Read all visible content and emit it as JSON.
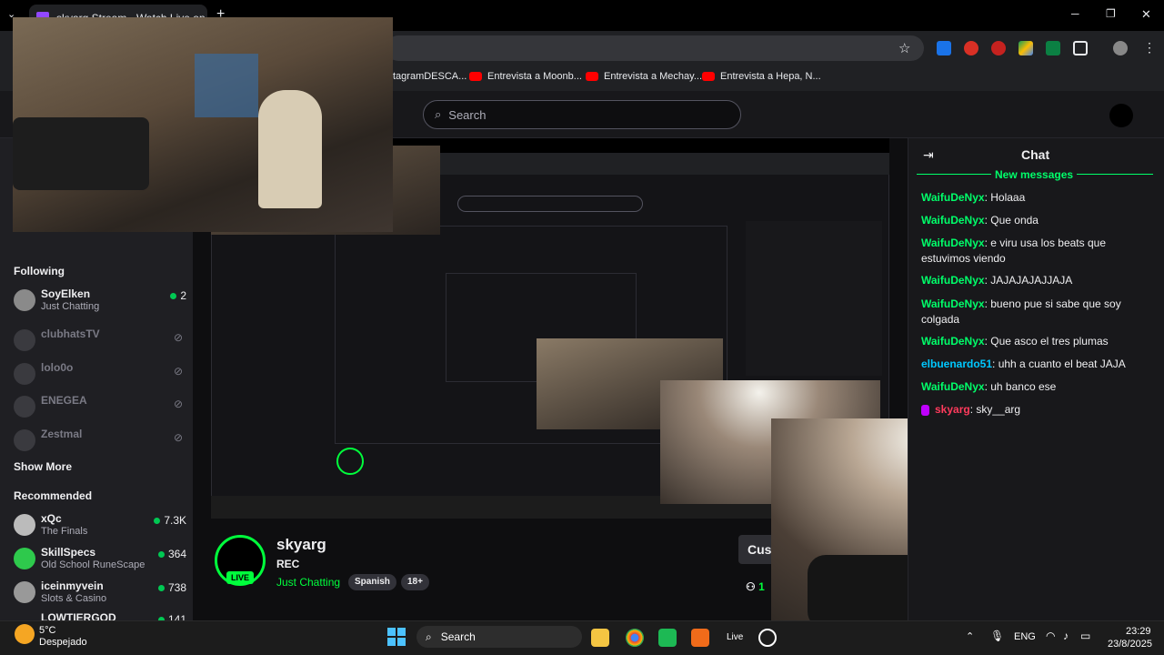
{
  "browser": {
    "tab_title": "skyarg Stream - Watch Live on",
    "new_tab": "+",
    "window_controls": {
      "minimize": "─",
      "maximize": "❐",
      "close": "✕"
    },
    "bookmarks": [
      {
        "label": "tagramDESCA...",
        "yt": false
      },
      {
        "label": "Entrevista a Moonb...",
        "yt": true
      },
      {
        "label": "Entrevista a Mechay...",
        "yt": true
      },
      {
        "label": "Entrevista a Hepa, N...",
        "yt": true
      }
    ],
    "star": "☆"
  },
  "twitch": {
    "search_placeholder": "Search",
    "sidebar": {
      "following_title": "Following",
      "following": [
        {
          "name": "SoyElken",
          "game": "Just Chatting",
          "viewers": "2",
          "online": true
        },
        {
          "name": "clubhatsTV",
          "online": false
        },
        {
          "name": "lolo0o",
          "online": false
        },
        {
          "name": "ENEGEA",
          "online": false
        },
        {
          "name": "Zestmal",
          "online": false
        }
      ],
      "show_more": "Show More",
      "recommended_title": "Recommended",
      "recommended": [
        {
          "name": "xQc",
          "game": "The Finals",
          "viewers": "7.3K"
        },
        {
          "name": "SkillSpecs",
          "game": "Old School RuneScape",
          "viewers": "364"
        },
        {
          "name": "iceinmyvein",
          "game": "Slots & Casino",
          "viewers": "738"
        },
        {
          "name": "LOWTIERGOD",
          "game": "",
          "viewers": "141"
        }
      ]
    },
    "chat": {
      "title": "Chat",
      "new_messages": "New messages",
      "messages": [
        {
          "user": "WaifuDeNyx",
          "text": "Holaaa"
        },
        {
          "user": "WaifuDeNyx",
          "text": "Que onda"
        },
        {
          "user": "WaifuDeNyx",
          "text": "e viru usa los beats que estuvimos viendo"
        },
        {
          "user": "WaifuDeNyx",
          "text": "JAJAJAJAJJAJA"
        },
        {
          "user": "WaifuDeNyx",
          "text": "bueno pue si sabe que soy colgada"
        },
        {
          "user": "WaifuDeNyx",
          "text": "Que asco el tres plumas"
        },
        {
          "user": "elbuenardo51",
          "text": "uhh a cuanto el beat JAJA"
        },
        {
          "user": "WaifuDeNyx",
          "text": "uh banco ese"
        },
        {
          "user": "skyarg",
          "text": "sky__arg"
        }
      ]
    },
    "channel": {
      "name": "skyarg",
      "title": "REC",
      "category": "Just Chatting",
      "tags": [
        "Spanish",
        "18+"
      ],
      "live_badge": "LIVE",
      "custom_btn": "Cus",
      "viewers_partial": "1"
    }
  },
  "taskbar": {
    "weather_temp": "5°C",
    "weather_desc": "Despejado",
    "search": "Search",
    "live_label": "Live",
    "lang": "ENG",
    "time": "23:29",
    "date": "23/8/2025"
  },
  "colors": {
    "accent_green": "#00ff3c",
    "twitch_purple": "#9147ff",
    "chat_user": "#00ff6a"
  }
}
